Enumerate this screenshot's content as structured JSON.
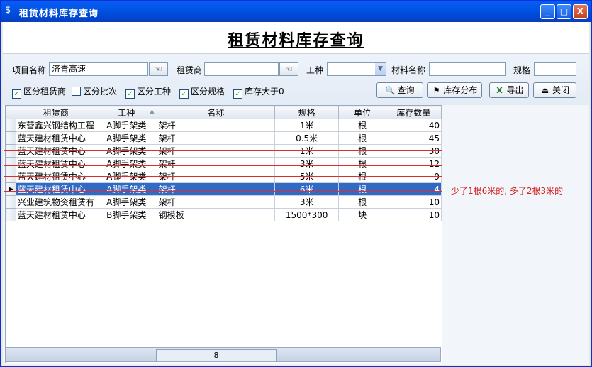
{
  "window": {
    "title": "租赁材料库存查询",
    "controls": [
      "_",
      "□",
      "X"
    ]
  },
  "banner": {
    "title": "租赁材料库存查询"
  },
  "filters": {
    "project_label": "项目名称",
    "project_value": "济青高速",
    "lessor_label": "租赁商",
    "lessor_value": "",
    "trade_label": "工种",
    "trade_value": "",
    "material_label": "材料名称",
    "material_value": "",
    "spec_label": "规格",
    "spec_value": ""
  },
  "checkboxes": [
    {
      "label": "区分租赁商",
      "checked": true
    },
    {
      "label": "区分批次",
      "checked": false
    },
    {
      "label": "区分工种",
      "checked": true
    },
    {
      "label": "区分规格",
      "checked": true
    },
    {
      "label": "库存大于0",
      "checked": true
    }
  ],
  "buttons": {
    "query": "查询",
    "distribution": "库存分布",
    "export": "导出",
    "close": "关闭"
  },
  "table": {
    "headers": [
      "租赁商",
      "工种",
      "名称",
      "规格",
      "单位",
      "库存数量"
    ],
    "rows": [
      [
        "东营鑫兴钢结构工程",
        "A脚手架类",
        "架杆",
        "1米",
        "根",
        "40"
      ],
      [
        "蓝天建材租赁中心",
        "A脚手架类",
        "架杆",
        "0.5米",
        "根",
        "45"
      ],
      [
        "蓝天建材租赁中心",
        "A脚手架类",
        "架杆",
        "1米",
        "根",
        "30"
      ],
      [
        "蓝天建材租赁中心",
        "A脚手架类",
        "架杆",
        "3米",
        "根",
        "12"
      ],
      [
        "蓝天建材租赁中心",
        "A脚手架类",
        "架杆",
        "5米",
        "根",
        "9"
      ],
      [
        "蓝天建材租赁中心",
        "A脚手架类",
        "架杆",
        "6米",
        "根",
        "4"
      ],
      [
        "兴业建筑物资租赁有",
        "A脚手架类",
        "架杆",
        "3米",
        "根",
        "10"
      ],
      [
        "蓝天建材租赁中心",
        "B脚手架类",
        "钢模板",
        "1500*300",
        "块",
        "10"
      ]
    ],
    "selected_row": 5
  },
  "footer": {
    "count": "8"
  },
  "annotation": {
    "note": "少了1根6米的, 多了2根3米的",
    "color": "#d41e1e"
  }
}
